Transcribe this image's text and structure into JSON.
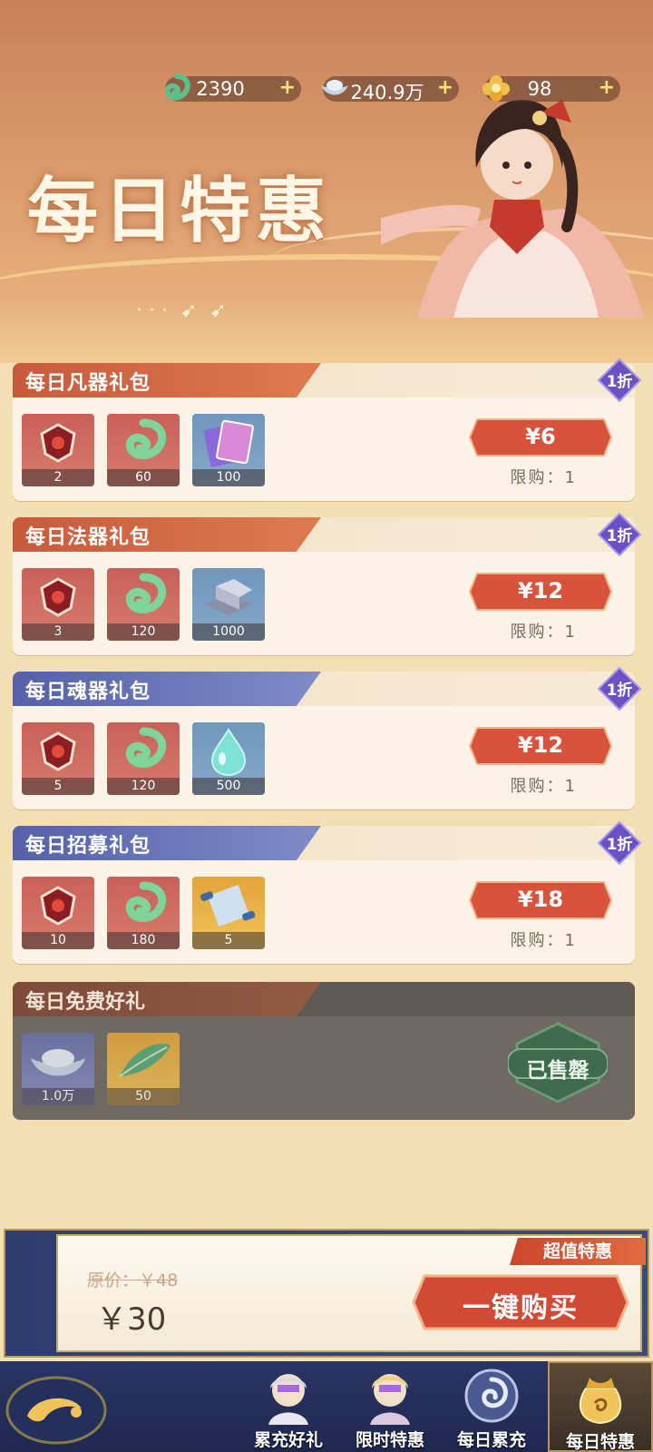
{
  "header": {
    "title": "每日特惠",
    "currencies": [
      {
        "icon": "jade-icon",
        "value": "2390"
      },
      {
        "icon": "silver-ingot-icon",
        "value": "240.9万"
      },
      {
        "icon": "gold-flower-icon",
        "value": "98"
      }
    ]
  },
  "packs": [
    {
      "title": "每日凡器礼包",
      "discount": "1折",
      "price": "¥6",
      "limit": "限购：1",
      "items": [
        {
          "icon": "red-token-icon",
          "qty": "2"
        },
        {
          "icon": "jade-icon",
          "qty": "60"
        },
        {
          "icon": "card-pack-icon",
          "qty": "100"
        }
      ]
    },
    {
      "title": "每日法器礼包",
      "discount": "1折",
      "price": "¥12",
      "limit": "限购：1",
      "items": [
        {
          "icon": "red-token-icon",
          "qty": "3"
        },
        {
          "icon": "jade-icon",
          "qty": "120"
        },
        {
          "icon": "iron-ingot-icon",
          "qty": "1000"
        }
      ]
    },
    {
      "title": "每日魂器礼包",
      "discount": "1折",
      "price": "¥12",
      "limit": "限购：1",
      "items": [
        {
          "icon": "red-token-icon",
          "qty": "5"
        },
        {
          "icon": "jade-icon",
          "qty": "120"
        },
        {
          "icon": "water-drop-icon",
          "qty": "500"
        }
      ]
    },
    {
      "title": "每日招募礼包",
      "discount": "1折",
      "price": "¥18",
      "limit": "限购：1",
      "items": [
        {
          "icon": "red-token-icon",
          "qty": "10"
        },
        {
          "icon": "jade-icon",
          "qty": "180"
        },
        {
          "icon": "scroll-icon",
          "qty": "5"
        }
      ]
    }
  ],
  "free_pack": {
    "title": "每日免费好礼",
    "status": "已售罄",
    "items": [
      {
        "icon": "silver-ingot-icon",
        "qty": "1.0万"
      },
      {
        "icon": "green-feather-icon",
        "qty": "50"
      }
    ]
  },
  "bundle": {
    "original_price": "原价：￥48",
    "price": "￥30",
    "tag": "超值特惠",
    "buy_label": "一键购买"
  },
  "nav": {
    "tabs": [
      {
        "label": "累充好礼",
        "icon": "character-icon"
      },
      {
        "label": "限时特惠",
        "icon": "character-icon"
      },
      {
        "label": "每日累充",
        "icon": "swirl-orb-icon"
      },
      {
        "label": "每日特惠",
        "icon": "gold-pouch-icon"
      }
    ]
  }
}
